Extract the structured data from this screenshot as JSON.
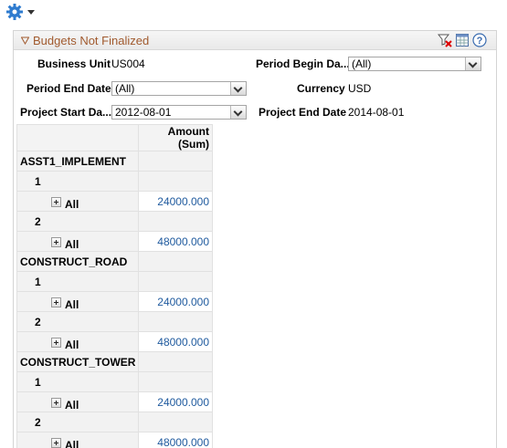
{
  "colors": {
    "title": "#a15a2e",
    "link": "#1f5a9e",
    "gear": "#2e7bcf"
  },
  "toolbar": {
    "icons": [
      "gear-icon",
      "dropdown-caret-icon"
    ]
  },
  "panel": {
    "title": "Budgets Not Finalized",
    "header_icons": [
      "clear-filter-icon",
      "grid-view-icon",
      "help-icon"
    ]
  },
  "filters": {
    "business_unit": {
      "label": "Business Unit",
      "value": "US004"
    },
    "period_begin": {
      "label": "Period Begin Da...",
      "value": "(All)"
    },
    "period_end": {
      "label": "Period End Date",
      "value": "(All)"
    },
    "currency": {
      "label": "Currency",
      "value": "USD"
    },
    "project_start": {
      "label": "Project Start Da...",
      "value": "2012-08-01"
    },
    "project_end": {
      "label": "Project End Date",
      "value": "2014-08-01"
    }
  },
  "grid": {
    "column_header": "Amount (Sum)",
    "groups": [
      {
        "name": "ASST1_IMPLEMENT",
        "rows": [
          {
            "key": "1",
            "label": "All",
            "amount": "24000.000"
          },
          {
            "key": "2",
            "label": "All",
            "amount": "48000.000"
          }
        ]
      },
      {
        "name": "CONSTRUCT_ROAD",
        "rows": [
          {
            "key": "1",
            "label": "All",
            "amount": "24000.000"
          },
          {
            "key": "2",
            "label": "All",
            "amount": "48000.000"
          }
        ]
      },
      {
        "name": "CONSTRUCT_TOWER",
        "rows": [
          {
            "key": "1",
            "label": "All",
            "amount": "24000.000"
          },
          {
            "key": "2",
            "label": "All",
            "amount": "48000.000"
          }
        ]
      }
    ]
  }
}
